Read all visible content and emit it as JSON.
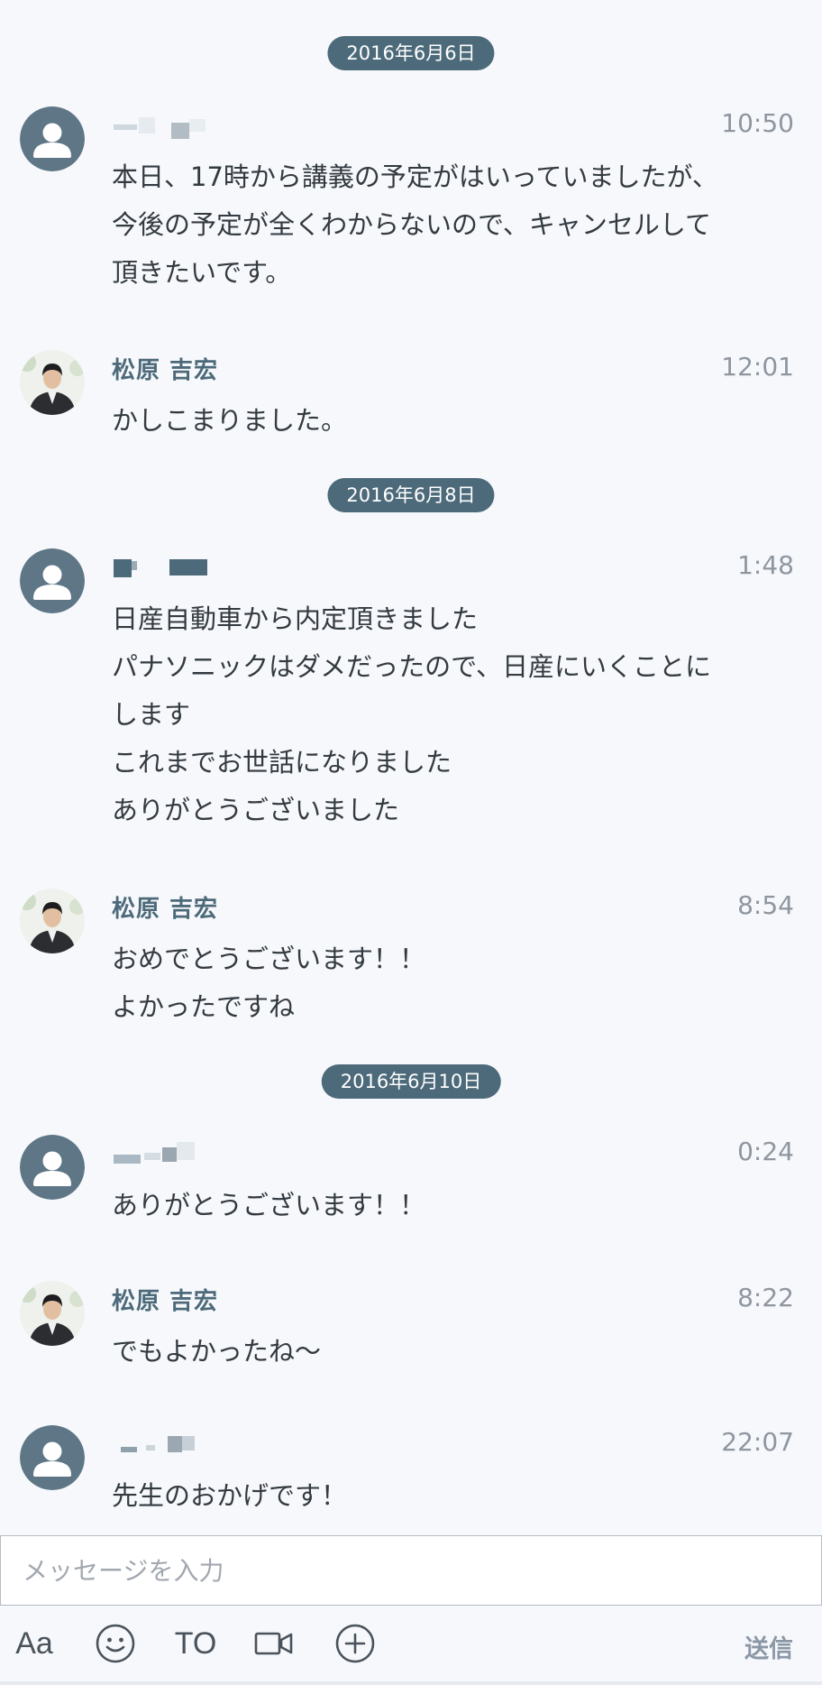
{
  "dates": [
    "2016年6月6日",
    "2016年6月8日",
    "2016年6月10日"
  ],
  "messages": [
    {
      "sender": "",
      "time": "10:50",
      "lines": [
        "本日、17時から講義の予定がはいっていましたが、",
        "今後の予定が全くわからないので、キャンセルして",
        "頂きたいです。"
      ]
    },
    {
      "sender": "松原 吉宏",
      "time": "12:01",
      "lines": [
        "かしこまりました。"
      ]
    },
    {
      "sender": "",
      "time": "1:48",
      "lines": [
        "日産自動車から内定頂きました",
        "パナソニックはダメだったので、日産にいくことに",
        "します",
        "これまでお世話になりました",
        "ありがとうございました"
      ]
    },
    {
      "sender": "松原 吉宏",
      "time": "8:54",
      "lines": [
        "おめでとうございます！！",
        "よかったですね"
      ]
    },
    {
      "sender": "",
      "time": "0:24",
      "lines": [
        "ありがとうございます！！"
      ]
    },
    {
      "sender": "松原 吉宏",
      "time": "8:22",
      "lines": [
        "でもよかったね〜"
      ]
    },
    {
      "sender": "",
      "time": "22:07",
      "lines": [
        "先生のおかげです！"
      ]
    }
  ],
  "composer": {
    "placeholder": "メッセージを入力",
    "format_label": "Aa",
    "to_label": "TO",
    "send_label": "送信",
    "icons": [
      "emoji-icon",
      "video-icon",
      "add-icon"
    ]
  },
  "colors": {
    "background": "#f6f8fb",
    "accent": "#4d6a7a",
    "time": "#8f96a0",
    "send": "#8b97a6"
  }
}
